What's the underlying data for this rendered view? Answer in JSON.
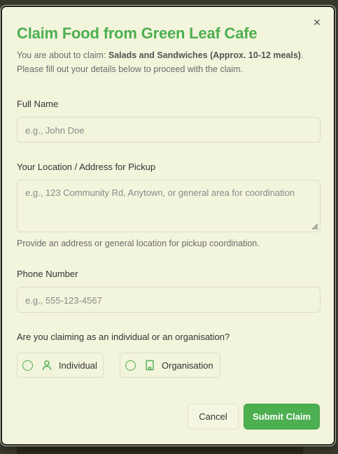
{
  "modal": {
    "title": "Claim Food from Green Leaf Cafe",
    "intro_prefix": "You are about to claim: ",
    "item_name": "Salads and Sandwiches (Approx. 10-12 meals)",
    "intro_suffix": ".",
    "intro_line2": "Please fill out your details below to proceed with the claim.",
    "close_symbol": "×"
  },
  "form": {
    "full_name": {
      "label": "Full Name",
      "placeholder": "e.g., John Doe",
      "value": ""
    },
    "location": {
      "label": "Your Location / Address for Pickup",
      "placeholder": "e.g., 123 Community Rd, Anytown, or general area for coordination",
      "value": "",
      "help": "Provide an address or general location for pickup coordination."
    },
    "phone": {
      "label": "Phone Number",
      "placeholder": "e.g., 555-123-4567",
      "value": ""
    },
    "claimant_type": {
      "question": "Are you claiming as an individual or an organisation?",
      "options": [
        {
          "label": "Individual",
          "icon": "user-icon",
          "selected": false
        },
        {
          "label": "Organisation",
          "icon": "building-icon",
          "selected": false
        }
      ]
    }
  },
  "actions": {
    "cancel_label": "Cancel",
    "submit_label": "Submit Claim"
  },
  "colors": {
    "accent": "#4caf50",
    "background": "#f3f4dc",
    "text": "#333333",
    "muted": "#6b6b6b"
  }
}
